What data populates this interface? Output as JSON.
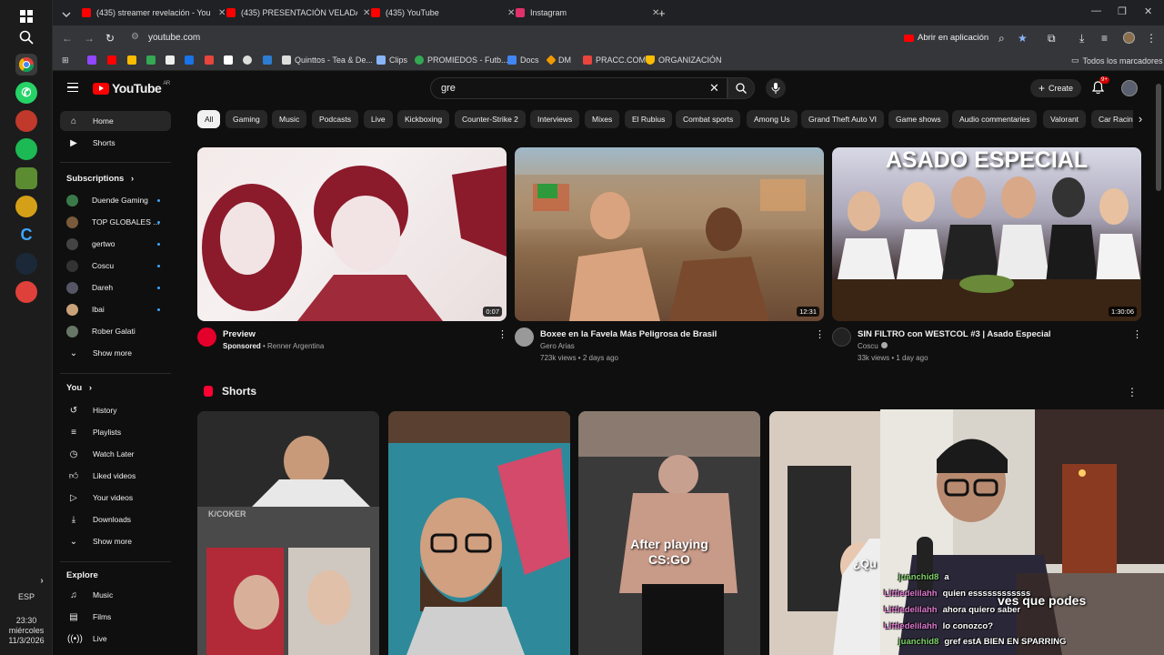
{
  "taskbar": {
    "lang": "ESP",
    "time": "23:30",
    "day": "miércoles",
    "date": "11/3/2026"
  },
  "tabs": [
    {
      "title": "(435) streamer revelación - You",
      "color": "#ff0000"
    },
    {
      "title": "(435) PRESENTACIÓN VELADA",
      "color": "#ff0000"
    },
    {
      "title": "(435) YouTube",
      "color": "#ff0000"
    },
    {
      "title": "Instagram",
      "color": "#e1306c"
    }
  ],
  "browser": {
    "url": "youtube.com",
    "open_in_app": "Abrir en aplicación",
    "all_bookmarks": "Todos los marcadores"
  },
  "bookmarks": [
    {
      "label": "Quinttos - Tea & De...",
      "color": "#dddddd"
    },
    {
      "label": "Clips",
      "color": "#8ab4f8"
    },
    {
      "label": "PROMIEDOS - Futb...",
      "color": "#34a853"
    },
    {
      "label": "Docs",
      "color": "#4285f4"
    },
    {
      "label": "DM",
      "color": "#f29900"
    },
    {
      "label": "PRACC.COM",
      "color": "#e8453c"
    },
    {
      "label": "ORGANIZACIÓN",
      "color": "#fbbc04"
    }
  ],
  "header": {
    "logo": "YouTube",
    "region": "AR",
    "search_value": "gre",
    "create": "Create",
    "notif_badge": "9+"
  },
  "guide": {
    "home": "Home",
    "shorts": "Shorts",
    "subscriptions_label": "Subscriptions",
    "subscriptions": [
      {
        "name": "Duende Gaming",
        "color": "#3a7a4a"
      },
      {
        "name": "TOP GLOBALES ...",
        "color": "#7a5a3a"
      },
      {
        "name": "gertwo",
        "color": "#444444"
      },
      {
        "name": "Coscu",
        "color": "#333333"
      },
      {
        "name": "Dareh",
        "color": "#555566"
      },
      {
        "name": "Ibai",
        "color": "#c9a27a"
      },
      {
        "name": "Rober Galati",
        "color": "#667766"
      }
    ],
    "show_more": "Show more",
    "you_label": "You",
    "you_items": [
      {
        "label": "History",
        "icon": "history-icon"
      },
      {
        "label": "Playlists",
        "icon": "playlists-icon"
      },
      {
        "label": "Watch Later",
        "icon": "clock-icon"
      },
      {
        "label": "Liked videos",
        "icon": "thumb-up-icon"
      },
      {
        "label": "Your videos",
        "icon": "video-icon"
      },
      {
        "label": "Downloads",
        "icon": "download-icon"
      },
      {
        "label": "Show more",
        "icon": "chevron-down-icon"
      }
    ],
    "explore_label": "Explore",
    "explore_items": [
      {
        "label": "Music",
        "icon": "music-icon"
      },
      {
        "label": "Films",
        "icon": "film-icon"
      },
      {
        "label": "Live",
        "icon": "live-icon"
      }
    ]
  },
  "chips": [
    "All",
    "Gaming",
    "Music",
    "Podcasts",
    "Live",
    "Kickboxing",
    "Counter-Strike 2",
    "Interviews",
    "Mixes",
    "El Rubius",
    "Combat sports",
    "Among Us",
    "Grand Theft Auto VI",
    "Game shows",
    "Audio commentaries",
    "Valorant",
    "Car Racin"
  ],
  "videos": [
    {
      "title": "Preview",
      "channel": "Sponsored",
      "channel_suffix": " • Renner Argentina",
      "stats": "",
      "duration": "0:07",
      "thumb_color": "#f4eaea",
      "avatar_color": "#e4002b"
    },
    {
      "title": "Boxee en la Favela Más Peligrosa de Brasil",
      "channel": "Gero Arias",
      "channel_suffix": "",
      "stats": "723k views • 2 days ago",
      "duration": "12:31",
      "thumb_color": "#8a6a4a",
      "avatar_color": "#999999"
    },
    {
      "title": "SIN FILTRO con WESTCOL #3 | Asado Especial",
      "channel": "Coscu",
      "channel_suffix": "",
      "stats": "33k views • 1 day ago",
      "duration": "1:30:06",
      "thumb_color": "#3a2a2a",
      "avatar_color": "#222222"
    }
  ],
  "thumb_texts": {
    "asado": "ASADO ESPECIAL"
  },
  "shorts": {
    "title": "Shorts",
    "items": [
      {
        "overlay": "K/COKER",
        "color": "#4a4a4a"
      },
      {
        "overlay": "",
        "color": "#3a5a6a"
      },
      {
        "overlay": "After playing CS:GO",
        "color": "#6a5a50"
      },
      {
        "overlay": "¿Qu",
        "color": "#8a7a6a"
      }
    ]
  },
  "stream_overlay": {
    "caption": "ves que podes",
    "chat": [
      {
        "user": "juanchid8",
        "msg": "a",
        "color": "#7fd36a"
      },
      {
        "user": "Littledelilahh",
        "msg": "quien essssssssssss",
        "color": "#e07ad0"
      },
      {
        "user": "Littledelilahh",
        "msg": "ahora quiero saber",
        "color": "#e07ad0"
      },
      {
        "user": "Littledelilahh",
        "msg": "lo conozco?",
        "color": "#e07ad0"
      },
      {
        "user": "juanchid8",
        "msg": "gref estA BIEN EN SPARRING",
        "color": "#7fd36a"
      }
    ]
  }
}
